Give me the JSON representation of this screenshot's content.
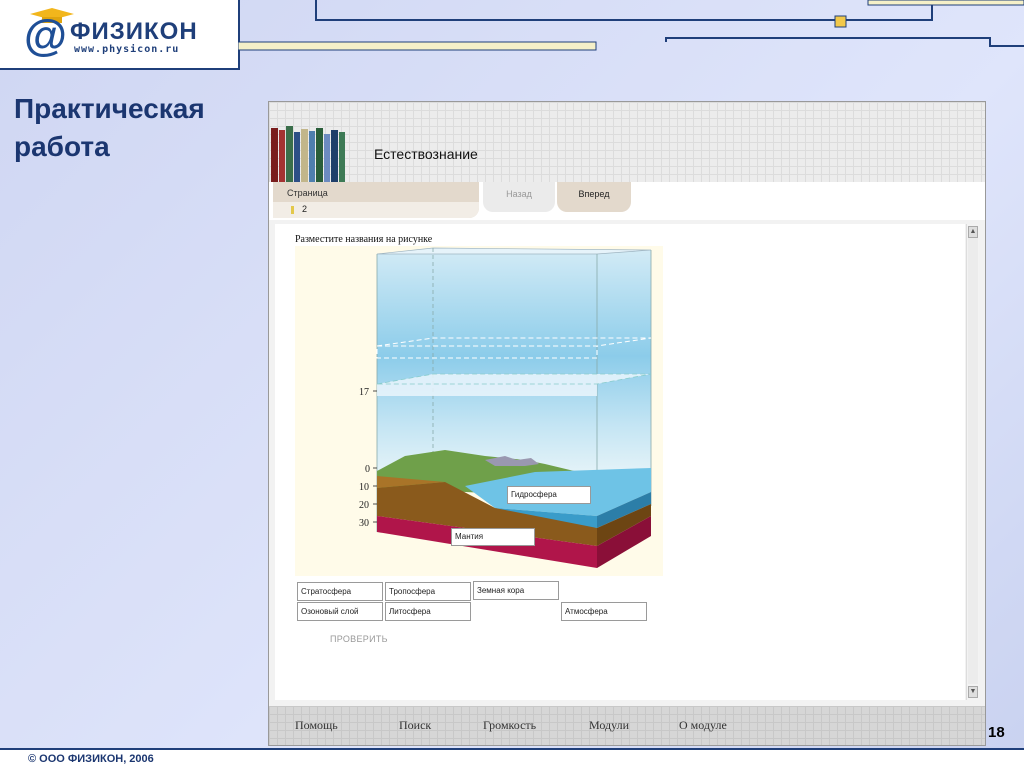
{
  "logo": {
    "name": "ФИЗИКОН",
    "url": "www.physicon.ru"
  },
  "slide": {
    "title_line1": "Практическая",
    "title_line2": "работа",
    "page_number": "18"
  },
  "footer": {
    "text": "© ООО ФИЗИКОН, 2006"
  },
  "app": {
    "title": "Естествознание",
    "nav": {
      "page_label": "Страница",
      "page_value": "2",
      "back_label": "Назад",
      "forward_label": "Вперед"
    },
    "instruction": "Разместите названия на рисунке",
    "figure": {
      "scale_ticks": [
        "17",
        "0",
        "10",
        "20",
        "30"
      ],
      "placed_labels": {
        "hydrosphere": "Гидросфера",
        "mantle": "Мантия"
      }
    },
    "options": {
      "row1": [
        "Стратосфера",
        "Тропосфера",
        "Земная кора"
      ],
      "row2": [
        "Озоновый слой",
        "Литосфера",
        "Атмосфера"
      ]
    },
    "check_label": "ПРОВЕРИТЬ",
    "menu": [
      "Помощь",
      "Поиск",
      "Громкость",
      "Модули",
      "О модуле"
    ]
  }
}
